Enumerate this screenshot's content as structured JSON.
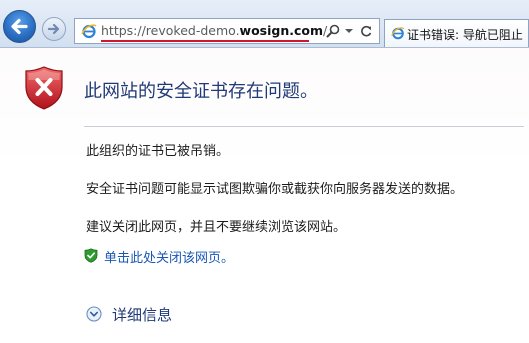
{
  "browser": {
    "url_prefix": "https://revoked-demo.",
    "url_domain": "wosign.com",
    "url_suffix": "/",
    "tab_title": "证书错误: 导航已阻止"
  },
  "icons": {
    "back": "back-arrow-icon",
    "forward": "forward-arrow-icon",
    "page": "ie-page-icon",
    "search": "search-icon",
    "dropdown": "dropdown-icon",
    "refresh": "refresh-icon",
    "tab": "ie-tab-icon",
    "error": "error-shield-icon",
    "safe": "green-shield-icon",
    "expand": "expand-chevron-icon"
  },
  "page": {
    "title": "此网站的安全证书存在问题。",
    "revoked_msg": "此组织的证书已被吊销。",
    "fraud_msg": "安全证书问题可能显示试图欺骗你或截获你向服务器发送的数据。",
    "advice_msg": "建议关闭此网页，并且不要继续浏览该网站。",
    "close_link": "单击此处关闭该网页。",
    "details_label": "详细信息"
  },
  "colors": {
    "title": "#1f3a76",
    "link": "#1a57b7",
    "error_red": "#d0162f",
    "safe_green": "#2f9a2f"
  }
}
